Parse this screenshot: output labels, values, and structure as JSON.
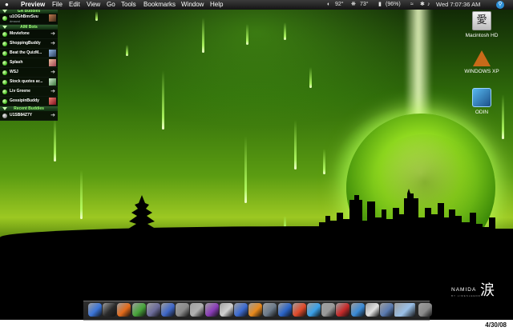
{
  "menubar": {
    "app_name": "Preview",
    "menus": [
      "File",
      "Edit",
      "View",
      "Go",
      "Tools",
      "Bookmarks",
      "Window",
      "Help"
    ],
    "status": {
      "temp1": "92°",
      "temp2": "73°",
      "battery": "(96%)",
      "datetime": "Wed 7:07:36 AM"
    }
  },
  "buddy_list": {
    "groups": [
      {
        "label": "GA Buddies"
      },
      {
        "label": "AIM Bots"
      },
      {
        "label": "Recent Buddies"
      }
    ],
    "me": {
      "name": "u1OGhBmrSvu",
      "sub": "dmacst"
    },
    "bots": [
      {
        "name": "Moviefone",
        "status": "online"
      },
      {
        "name": "ShoppingBuddy",
        "status": "online"
      },
      {
        "name": "Beat the QuizM...",
        "status": "online"
      },
      {
        "name": "Splash",
        "status": "online"
      },
      {
        "name": "WSJ",
        "status": "online"
      },
      {
        "name": "Stock quotes ar...",
        "status": "online"
      },
      {
        "name": "Liv Greene",
        "status": "online"
      },
      {
        "name": "GossipinBuddy",
        "status": "online"
      }
    ],
    "recent": [
      {
        "name": "U1SB84Z7Y",
        "status": "idle"
      }
    ]
  },
  "desktop_icons": [
    {
      "label": "Macintosh HD",
      "icon": "hard-drive-icon"
    },
    {
      "label": "WINDOWS XP",
      "icon": "windows-drive-icon"
    },
    {
      "label": "ODIN",
      "icon": "odin-drive-icon"
    }
  ],
  "dock": {
    "items": [
      {
        "icon": "finder-icon",
        "color": "#3a74d8"
      },
      {
        "icon": "dashboard-icon",
        "color": "#2b2b2b"
      },
      {
        "icon": "firefox-icon",
        "color": "#e36a1a"
      },
      {
        "icon": "adium-icon",
        "color": "#47a53a"
      },
      {
        "icon": "photo-icon",
        "color": "#6b6b9a"
      },
      {
        "icon": "itunes-icon",
        "color": "#3f67c8"
      },
      {
        "icon": "guitar-icon",
        "color": "#8a8a8a"
      },
      {
        "icon": "game-icon",
        "color": "#b0b0b0"
      },
      {
        "icon": "podcast-icon",
        "color": "#8a3cb8"
      },
      {
        "icon": "garageband-icon",
        "color": "#d0d0d0"
      },
      {
        "icon": "preview-icon",
        "color": "#3c6bd1"
      },
      {
        "icon": "vlc-icon",
        "color": "#e8891c"
      },
      {
        "icon": "calculator-icon",
        "color": "#6c7a8a"
      },
      {
        "icon": "dictionary-icon",
        "color": "#2a64c8"
      },
      {
        "icon": "cross-icon",
        "color": "#e04a2a"
      },
      {
        "icon": "quicktime-icon",
        "color": "#3aa0e8"
      },
      {
        "icon": "system-preferences-icon",
        "color": "#9a9a9a"
      },
      {
        "icon": "photoshop-icon",
        "color": "#c62a2a"
      },
      {
        "icon": "mail-icon",
        "color": "#3a8ad6"
      },
      {
        "icon": "calendar-icon",
        "color": "#e0e0e0"
      },
      {
        "icon": "folder-icon",
        "color": "#5a7ab0"
      },
      {
        "icon": "display-icon",
        "color": "#9ac0e8"
      },
      {
        "icon": "trash-icon",
        "color": "#8a8a8a"
      }
    ]
  },
  "branding": {
    "name": "NAMIDA",
    "kanji": "涙",
    "by": "BY LIMESLEEDD"
  },
  "caption": "4/30/08"
}
